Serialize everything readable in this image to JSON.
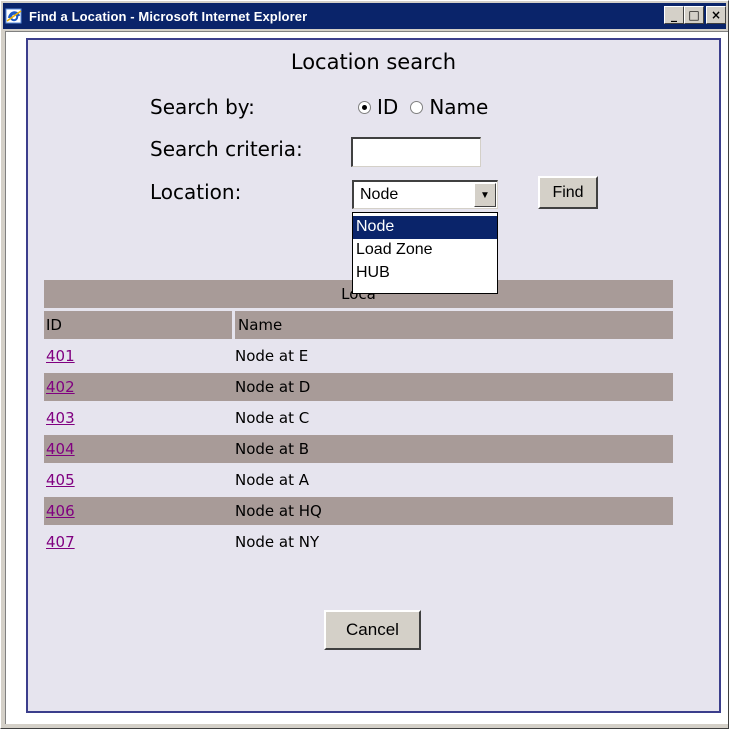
{
  "window": {
    "title": "Find a Location - Microsoft Internet Explorer",
    "buttons": {
      "minimize": "_",
      "maximize": "□",
      "close": "×"
    }
  },
  "form": {
    "heading": "Location search",
    "search_by_label": "Search by:",
    "radio_options": [
      {
        "label": "ID",
        "checked": true
      },
      {
        "label": "Name",
        "checked": false
      }
    ],
    "criteria_label": "Search criteria:",
    "criteria_value": "",
    "location_label": "Location:",
    "location_selected": "Node",
    "find_button": "Find",
    "cancel_button": "Cancel"
  },
  "dropdown": {
    "options": [
      "Node",
      "Load Zone",
      "HUB"
    ],
    "highlighted": "Node"
  },
  "results": {
    "caption": "Loca",
    "columns": [
      "ID",
      "Name"
    ],
    "rows": [
      {
        "id": "401",
        "name": "Node at E"
      },
      {
        "id": "402",
        "name": "Node at D"
      },
      {
        "id": "403",
        "name": "Node at C"
      },
      {
        "id": "404",
        "name": "Node at B"
      },
      {
        "id": "405",
        "name": "Node at A"
      },
      {
        "id": "406",
        "name": "Node at HQ"
      },
      {
        "id": "407",
        "name": "Node at NY"
      }
    ]
  }
}
